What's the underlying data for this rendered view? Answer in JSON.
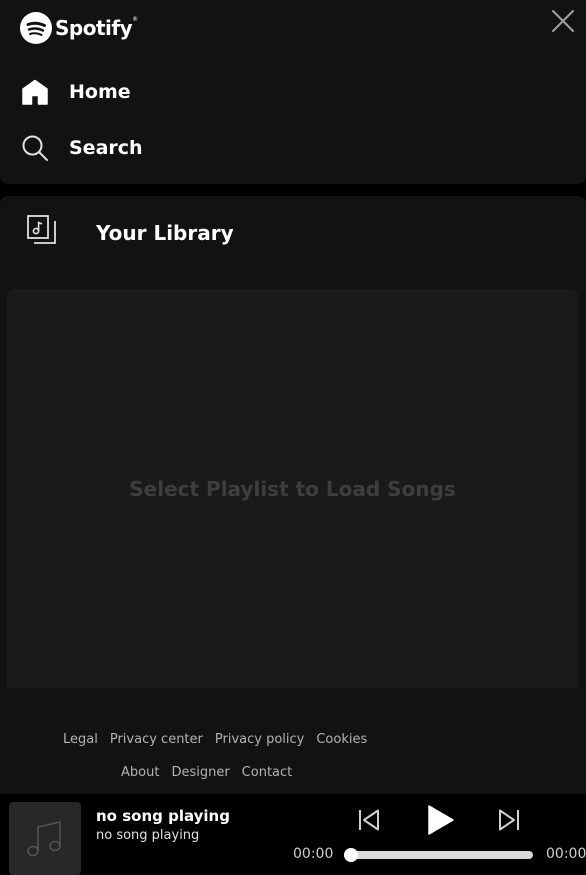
{
  "brand": {
    "name": "Spotify",
    "trademark": "®",
    "icon": "spotify-logo-icon"
  },
  "nav": {
    "close_icon": "close-icon",
    "items": [
      {
        "label": "Home",
        "icon": "home-icon"
      },
      {
        "label": "Search",
        "icon": "search-icon"
      }
    ]
  },
  "library": {
    "label": "Your Library",
    "icon": "library-icon",
    "empty_message": "Select Playlist to Load Songs"
  },
  "footer": {
    "row1": [
      "Legal",
      "Privacy center",
      "Privacy policy",
      "Cookies"
    ],
    "row2": [
      "About",
      "Designer",
      "Contact"
    ]
  },
  "player": {
    "title": "no song playing",
    "artist": "no song playing",
    "current_time": "00:00",
    "total_time": "00:00",
    "progress": 0,
    "accent": "#1db954"
  }
}
